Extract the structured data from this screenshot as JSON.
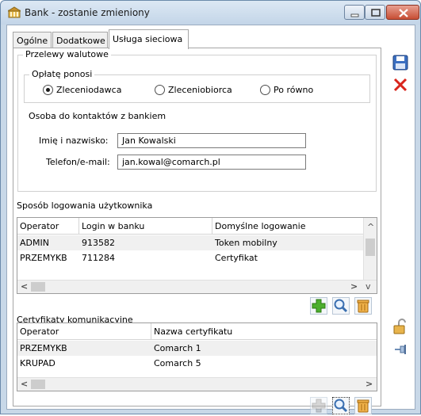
{
  "window": {
    "title": "Bank - zostanie zmieniony"
  },
  "tabs": [
    "Ogólne",
    "Dodatkowe",
    "Usługa sieciowa"
  ],
  "transfers": {
    "legend": "Przelewy walutowe",
    "fee_legend": "Opłatę ponosi",
    "options": [
      "Zleceniodawca",
      "Zleceniobiorca",
      "Po równo"
    ],
    "selected": "Zleceniodawca",
    "contact_heading": "Osoba do kontaktów z bankiem",
    "name_label": "Imię i nazwisko:",
    "name_value": "Jan Kowalski",
    "phone_label": "Telefon/e-mail:",
    "phone_value": "jan.kowal@comarch.pl"
  },
  "login": {
    "heading": "Sposób logowania użytkownika",
    "columns": [
      "Operator",
      "Login w banku",
      "Domyślne logowanie"
    ],
    "rows": [
      [
        "ADMIN",
        "913582",
        "Token mobilny"
      ],
      [
        "PRZEMYKB",
        "711284",
        "Certyfikat"
      ]
    ]
  },
  "certs": {
    "heading": "Certyfikaty komunikacyjne",
    "columns": [
      "Operator",
      "Nazwa certyfikatu"
    ],
    "rows": [
      [
        "PRZEMYKB",
        "Comarch 1"
      ],
      [
        "KRUPAD",
        "Comarch 5"
      ]
    ]
  },
  "colors": {
    "add_green": "#4caf2e",
    "delete_red": "#d9251c",
    "save_blue": "#3b6fc1",
    "trash_orange": "#c9852a"
  }
}
